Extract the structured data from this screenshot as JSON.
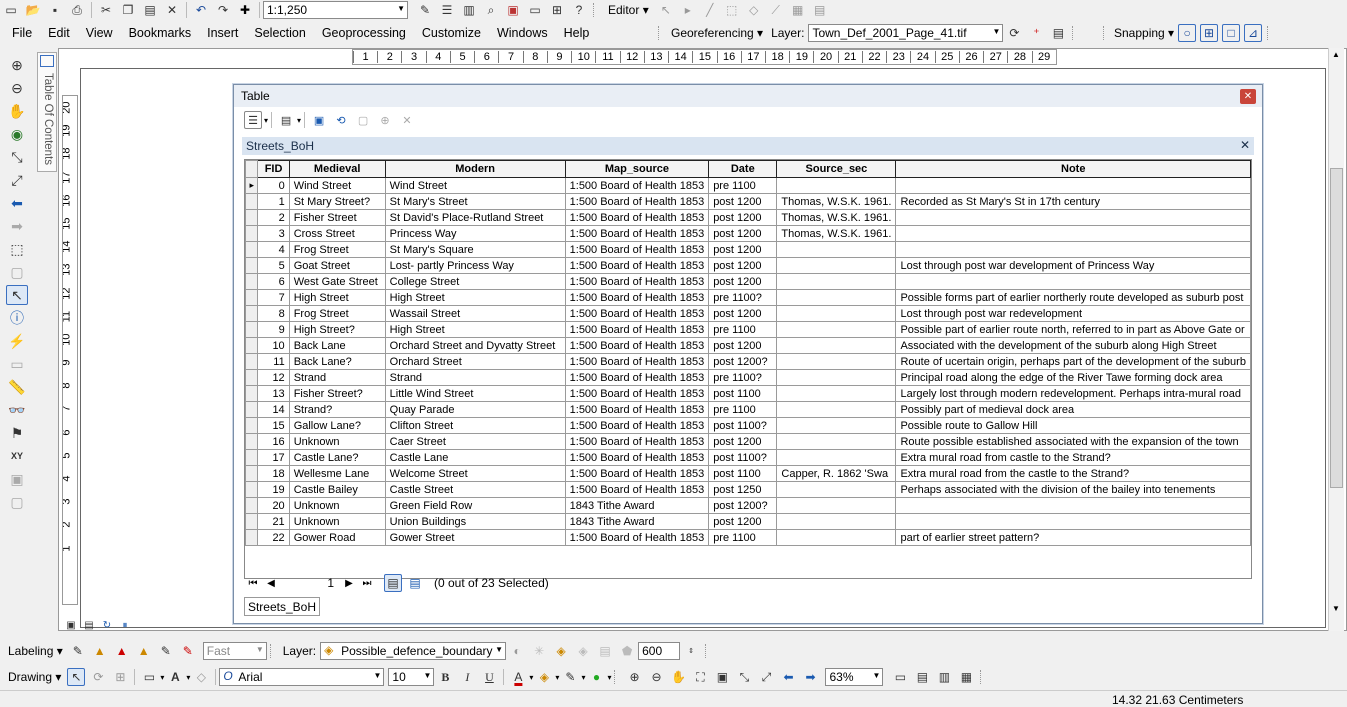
{
  "scale": "1:1,250",
  "menubar": {
    "items": [
      "File",
      "Edit",
      "View",
      "Bookmarks",
      "Insert",
      "Selection",
      "Geoprocessing",
      "Customize",
      "Windows",
      "Help"
    ]
  },
  "editor_label": "Editor",
  "georef": {
    "label": "Georeferencing",
    "layer_label": "Layer:",
    "layer_value": "Town_Def_2001_Page_41.tif"
  },
  "snapping_label": "Snapping",
  "toc_label": "Table Of Contents",
  "ruler_h": [
    "1",
    "2",
    "3",
    "4",
    "5",
    "6",
    "7",
    "8",
    "9",
    "10",
    "11",
    "12",
    "13",
    "14",
    "15",
    "16",
    "17",
    "18",
    "19",
    "20",
    "21",
    "22",
    "23",
    "24",
    "25",
    "26",
    "27",
    "28",
    "29"
  ],
  "ruler_v": [
    "20",
    "19",
    "18",
    "17",
    "16",
    "15",
    "14",
    "13",
    "12",
    "11",
    "10",
    "9",
    "8",
    "7",
    "6",
    "5",
    "4",
    "3",
    "2",
    "1"
  ],
  "table_window": {
    "title": "Table",
    "tab_name": "Streets_BoH",
    "columns": [
      "FID",
      "Medieval",
      "Modern",
      "Map_source",
      "Date",
      "Source_sec",
      "Note"
    ],
    "rows": [
      [
        "0",
        "Wind Street",
        "Wind Street",
        "1:500 Board of Health 1853",
        "pre 1100",
        "",
        ""
      ],
      [
        "1",
        "St Mary Street?",
        "St Mary's Street",
        "1:500 Board of Health 1853",
        "post 1200",
        "Thomas, W.S.K. 1961.",
        "Recorded as St Mary's St in 17th century"
      ],
      [
        "2",
        "Fisher Street",
        "St David's Place-Rutland Street",
        "1:500 Board of Health 1853",
        "post 1200",
        "Thomas, W.S.K. 1961.",
        ""
      ],
      [
        "3",
        "Cross Street",
        "Princess Way",
        "1:500 Board of Health 1853",
        "post 1200",
        "Thomas, W.S.K. 1961.",
        ""
      ],
      [
        "4",
        "Frog Street",
        "St Mary's Square",
        "1:500 Board of Health 1853",
        "post 1200",
        "",
        ""
      ],
      [
        "5",
        "Goat Street",
        "Lost- partly Princess Way",
        "1:500 Board of Health 1853",
        "post 1200",
        "",
        "Lost through post war development of Princess Way"
      ],
      [
        "6",
        "West Gate Street",
        "College Street",
        "1:500 Board of Health 1853",
        "post 1200",
        "",
        ""
      ],
      [
        "7",
        "High Street",
        "High Street",
        "1:500 Board of Health 1853",
        "pre 1100?",
        "",
        "Possible forms part of earlier northerly route developed as suburb post"
      ],
      [
        "8",
        "Frog Street",
        "Wassail Street",
        "1:500 Board of Health 1853",
        "post 1200",
        "",
        "Lost through post war redevelopment"
      ],
      [
        "9",
        "High Street?",
        "High Street",
        "1:500 Board of Health 1853",
        "pre 1100",
        "",
        "Possible part of earlier route north, referred to in part as Above Gate or"
      ],
      [
        "10",
        "Back Lane",
        "Orchard Street and Dyvatty Street",
        "1:500 Board of Health 1853",
        "post 1200",
        "",
        "Associated with the development of the suburb along High Street"
      ],
      [
        "11",
        "Back Lane?",
        "Orchard Street",
        "1:500 Board of Health 1853",
        "post 1200?",
        "",
        "Route of ucertain origin, perhaps part of the development of the suburb"
      ],
      [
        "12",
        "Strand",
        "Strand",
        "1:500 Board of Health 1853",
        "pre 1100?",
        "",
        "Principal road along the edge of the River Tawe forming dock area"
      ],
      [
        "13",
        "Fisher Street?",
        "Little Wind Street",
        "1:500 Board of Health 1853",
        "post 1100",
        "",
        "Largely lost through modern redevelopment. Perhaps intra-mural road"
      ],
      [
        "14",
        "Strand?",
        "Quay Parade",
        "1:500 Board of Health 1853",
        "pre 1100",
        "",
        "Possibly part of medieval dock area"
      ],
      [
        "15",
        "Gallow Lane?",
        "Clifton Street",
        "1:500 Board of Health 1853",
        "post 1100?",
        "",
        "Possible route to Gallow Hill"
      ],
      [
        "16",
        "Unknown",
        "Caer Street",
        "1:500 Board of Health 1853",
        "post 1200",
        "",
        "Route possible established associated with the expansion of the town"
      ],
      [
        "17",
        "Castle Lane?",
        "Castle Lane",
        "1:500 Board of Health 1853",
        "post 1100?",
        "",
        "Extra mural road from castle to the Strand?"
      ],
      [
        "18",
        "Wellesme Lane",
        "Welcome Street",
        "1:500 Board of Health 1853",
        "post 1100",
        "Capper, R. 1862 'Swa",
        "Extra mural road from the castle to the Strand?"
      ],
      [
        "19",
        "Castle Bailey",
        "Castle  Street",
        "1:500 Board of Health 1853",
        "post 1250",
        "",
        " Perhaps associated with the division of the bailey into tenements"
      ],
      [
        "20",
        "Unknown",
        "Green Field Row",
        "1843 Tithe Award",
        "post 1200?",
        "",
        ""
      ],
      [
        "21",
        "Unknown",
        "Union Buildings",
        "1843 Tithe Award",
        "post 1200",
        "",
        ""
      ],
      [
        "22",
        "Gower Road",
        "Gower Street",
        "1:500 Board of Health 1853",
        "pre 1100",
        "",
        "part of earlier street pattern?"
      ]
    ],
    "current_record": "1",
    "selection_status": "(0 out of 23 Selected)"
  },
  "labeling": {
    "label": "Labeling",
    "quality": "Fast",
    "layer_label": "Layer:",
    "layer_value": "Possible_defence_boundary",
    "scale_value": "600"
  },
  "drawing": {
    "label": "Drawing",
    "font": "Arial",
    "size": "10",
    "bold": "B",
    "italic": "I",
    "underline": "U",
    "text_tool": "A",
    "zoom": "63%"
  },
  "status": {
    "coords": "14.32  21.63 Centimeters"
  }
}
